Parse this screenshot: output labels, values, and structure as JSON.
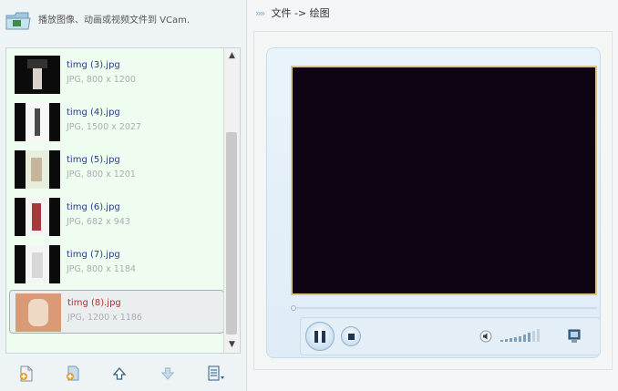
{
  "left_panel": {
    "title": "播放图像、动画或视频文件到 VCam.",
    "files": [
      {
        "name": "timg (3).jpg",
        "meta": "JPG, 800 x 1200",
        "selected": false
      },
      {
        "name": "timg (4).jpg",
        "meta": "JPG, 1500 x 2027",
        "selected": false
      },
      {
        "name": "timg (5).jpg",
        "meta": "JPG, 800 x 1201",
        "selected": false
      },
      {
        "name": "timg (6).jpg",
        "meta": "JPG, 682 x 943",
        "selected": false
      },
      {
        "name": "timg (7).jpg",
        "meta": "JPG, 800 x 1184",
        "selected": false
      },
      {
        "name": "timg (8).jpg",
        "meta": "JPG, 1200 x 1186",
        "selected": true
      }
    ],
    "toolbar": [
      {
        "name": "add-file-icon"
      },
      {
        "name": "add-folder-icon"
      },
      {
        "name": "move-up-icon"
      },
      {
        "name": "move-down-icon"
      },
      {
        "name": "list-menu-icon"
      }
    ]
  },
  "right_panel": {
    "breadcrumb_chevron": "»»",
    "breadcrumb": "文件 -> 绘图",
    "player": {
      "progress": 0,
      "state": "playing",
      "volume": 0.75
    }
  },
  "colors": {
    "accent": "#2a3a8a",
    "selected_text": "#b0312f",
    "video_bg": "#0e0412",
    "video_border": "#dcc48d",
    "list_bg": "#eefdf0"
  }
}
